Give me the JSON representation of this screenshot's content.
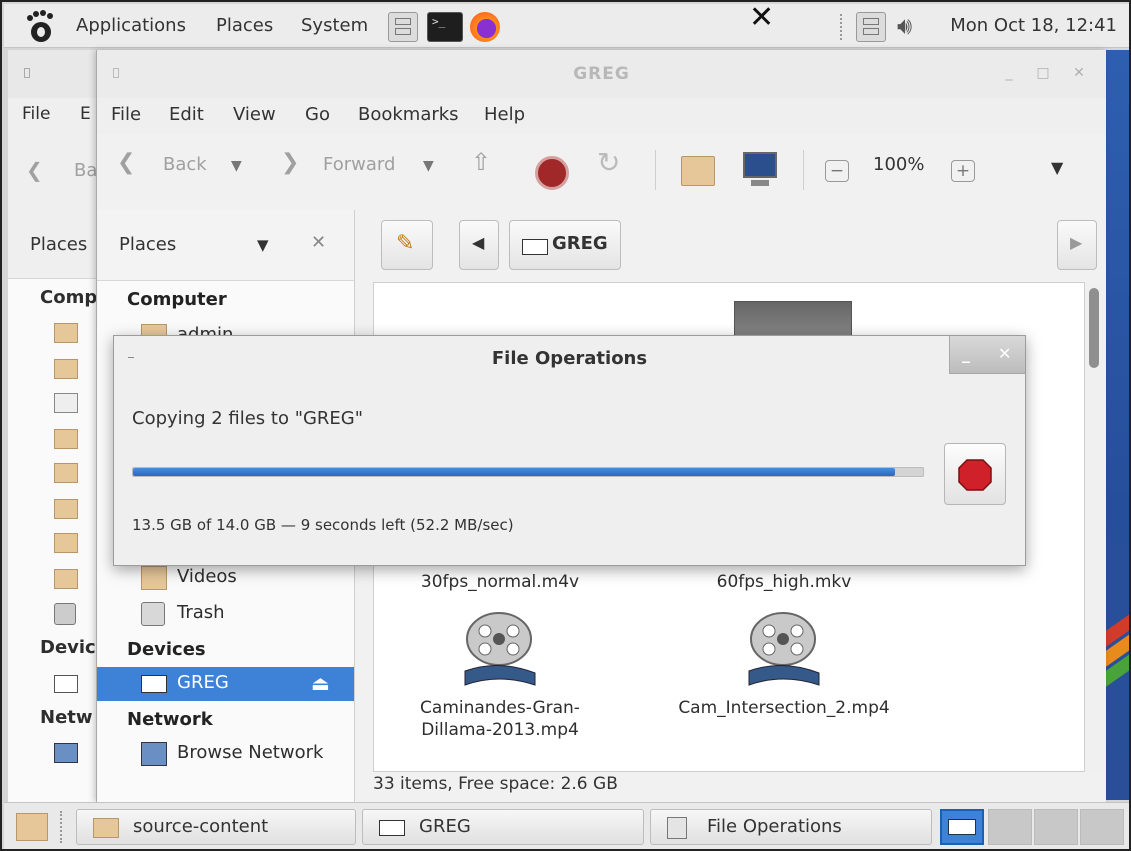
{
  "top_panel": {
    "menus": [
      "Applications",
      "Places",
      "System"
    ],
    "clock": "Mon Oct 18, 12:41"
  },
  "back_window": {
    "menu_file": "File",
    "menu_edit_partial": "E",
    "back_partial": "Ba",
    "places_label": "Places",
    "computer_partial": "Comp",
    "devices_partial": "Devic",
    "network_partial": "Netw"
  },
  "window": {
    "title": "GREG",
    "menus": [
      "File",
      "Edit",
      "View",
      "Go",
      "Bookmarks",
      "Help"
    ],
    "toolbar": {
      "back": "Back",
      "forward": "Forward",
      "zoom": "100%"
    },
    "sidebar": {
      "header": "Places",
      "computer_heading": "Computer",
      "items": [
        "admin",
        "Videos",
        "Trash"
      ],
      "devices_heading": "Devices",
      "device": "GREG",
      "network_heading": "Network",
      "network_item": "Browse Network"
    },
    "location": {
      "crumb": "GREG"
    },
    "files": [
      {
        "name": "30fps_normal.m4v"
      },
      {
        "name": "60fps_high.mkv"
      },
      {
        "name": "Caminandes-Gran-\nDillama-2013.mp4",
        "line1": "Caminandes-Gran-",
        "line2": "Dillama-2013.mp4"
      },
      {
        "name": "Cam_Intersection_2.mp4"
      }
    ],
    "status": "33 items, Free space: 2.6 GB"
  },
  "dialog": {
    "title": "File Operations",
    "message": "Copying 2 files to \"GREG\"",
    "progress": 0.964,
    "detail": "13.5 GB of 14.0 GB — 9 seconds left (52.2 MB/sec)"
  },
  "taskbar": {
    "tasks": [
      "source-content",
      "GREG",
      "File Operations"
    ]
  },
  "colors": {
    "selection": "#3d82d6",
    "progress": "#2a69bd",
    "stop": "#d0202a"
  }
}
